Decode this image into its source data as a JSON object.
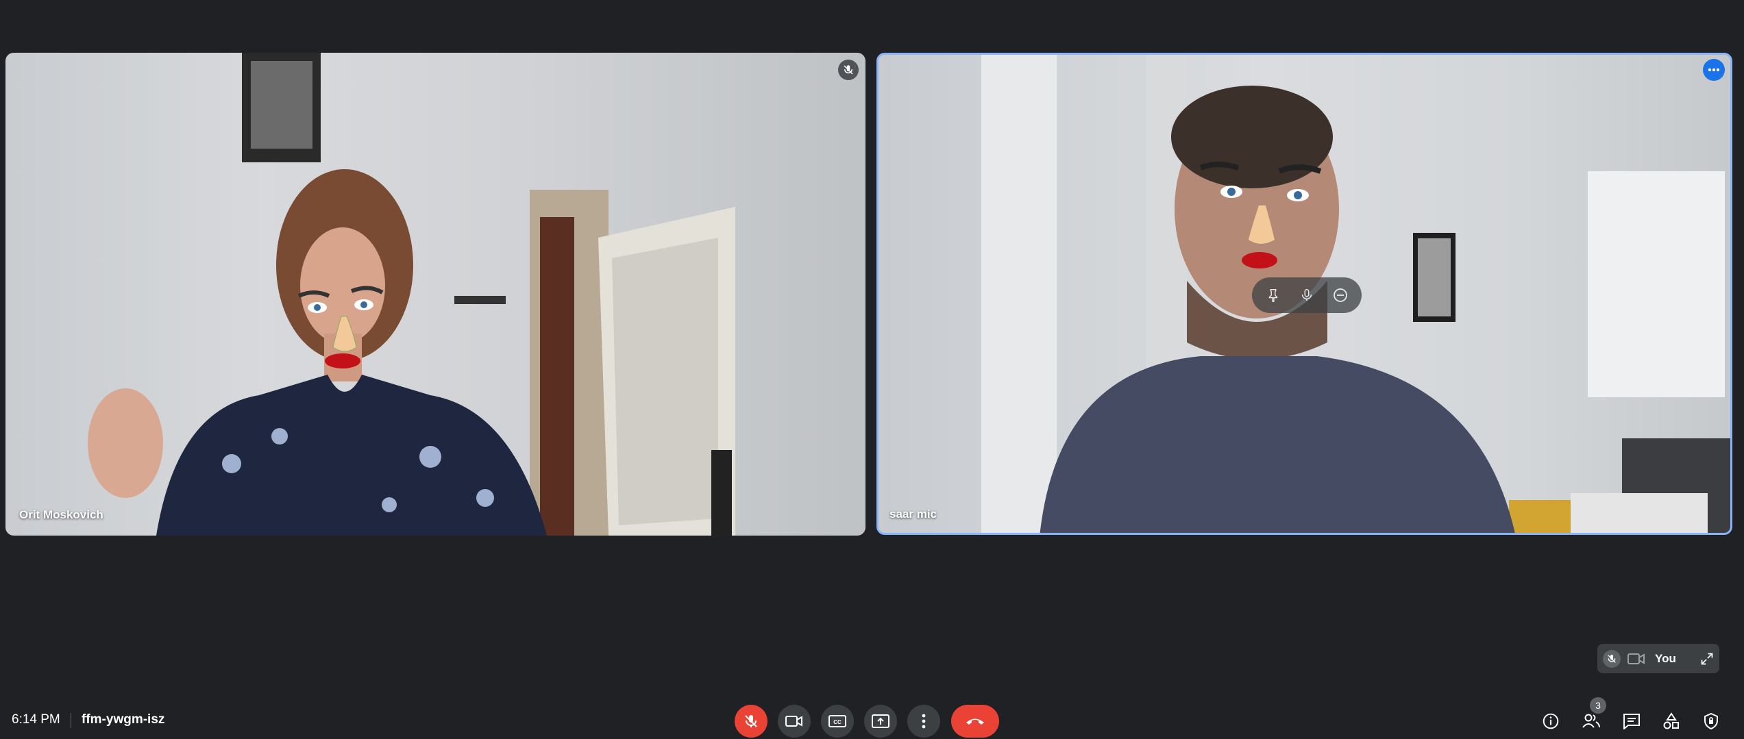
{
  "meeting": {
    "time": "6:14 PM",
    "code": "ffm-ywgm-isz"
  },
  "participants": [
    {
      "name": "Orit Moskovich",
      "muted": true
    },
    {
      "name": "saar mic",
      "muted": false
    }
  ],
  "self_preview": {
    "label": "You"
  },
  "people_count": "3",
  "colors": {
    "background": "#202124",
    "control": "#3c4043",
    "danger": "#ea4335",
    "accent": "#8ab4f8",
    "more_button": "#1a73e8"
  },
  "icons": {
    "tile_left_top_right": "mic-off-icon",
    "tile_right_top_right": "more-options-icon",
    "hover_controls": [
      "pin-icon",
      "mic-icon",
      "remove-icon"
    ],
    "self_preview": [
      "mic-off-icon",
      "camera-icon",
      "expand-icon"
    ],
    "controls": [
      "mic-off-icon",
      "camera-icon",
      "captions-icon",
      "present-icon",
      "more-vert-icon",
      "end-call-icon"
    ],
    "right_controls": [
      "info-icon",
      "people-icon",
      "chat-icon",
      "activities-icon",
      "host-controls-icon"
    ]
  }
}
